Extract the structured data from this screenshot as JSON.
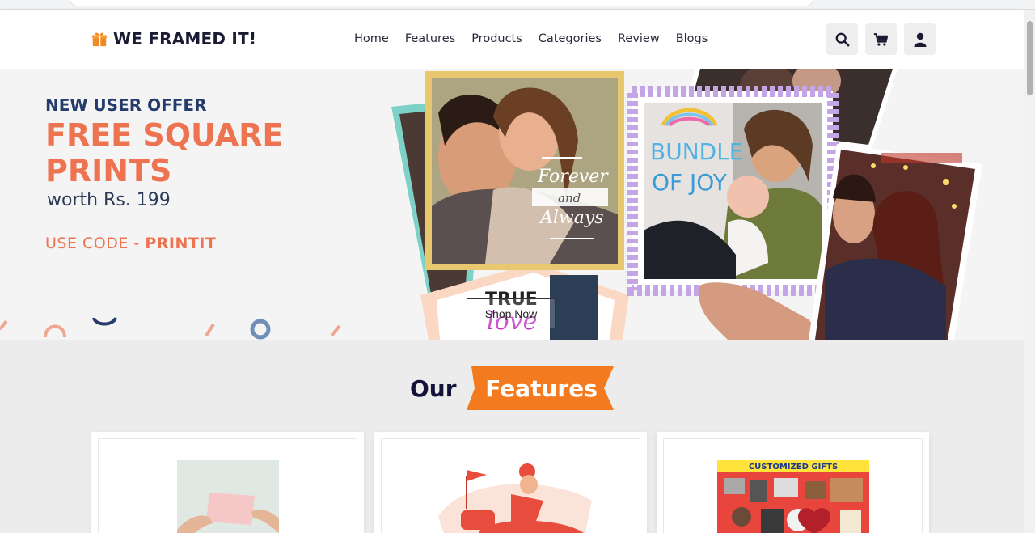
{
  "brand": {
    "name": "WE FRAMED IT!",
    "icon": "gift-icon",
    "icon_color": "#f08a24"
  },
  "nav": {
    "links": [
      "Home",
      "Features",
      "Products",
      "Categories",
      "Review",
      "Blogs"
    ],
    "icons": [
      "search-icon",
      "cart-icon",
      "user-icon"
    ]
  },
  "hero": {
    "offer_subtitle": "NEW USER OFFER",
    "offer_title": "FREE SQUARE PRINTS",
    "offer_worth": "worth Rs. 199",
    "code_prefix": "USE CODE - ",
    "code": "PRINTIT",
    "shop_button": "Shop Now",
    "photo_captions": {
      "forever": "Forever",
      "and": "and",
      "always": "Always",
      "bundle": "BUNDLE",
      "of_joy": "OF JOY",
      "true": "TRUE",
      "love": "love"
    }
  },
  "features": {
    "title_left": "Our",
    "title_badge": "Features",
    "card_gift_caption": "CUSTOMIZED GIFTS"
  },
  "colors": {
    "accent_orange": "#ee7350",
    "badge_orange": "#f47a1f",
    "navy": "#243b6b"
  }
}
